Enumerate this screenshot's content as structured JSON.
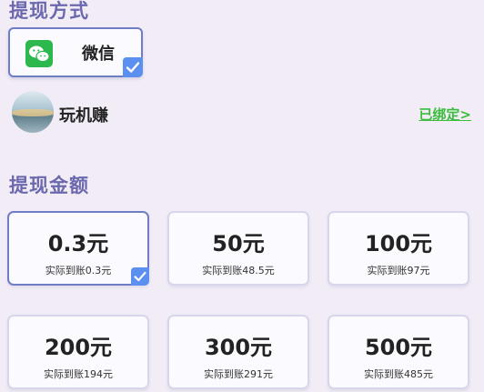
{
  "withdraw_method": {
    "title": "提现方式",
    "option": {
      "label": "微信",
      "icon": "wechat-icon",
      "selected": true
    },
    "account": {
      "name": "玩机赚",
      "bound_link": "已绑定>"
    }
  },
  "withdraw_amount": {
    "title": "提现金额",
    "options": [
      {
        "amount": "0.3元",
        "actual": "实际到账0.3元",
        "selected": true
      },
      {
        "amount": "50元",
        "actual": "实际到账48.5元",
        "selected": false
      },
      {
        "amount": "100元",
        "actual": "实际到账97元",
        "selected": false
      },
      {
        "amount": "200元",
        "actual": "实际到账194元",
        "selected": false
      },
      {
        "amount": "300元",
        "actual": "实际到账291元",
        "selected": false
      },
      {
        "amount": "500元",
        "actual": "实际到账485元",
        "selected": false
      }
    ]
  },
  "colors": {
    "accent": "#6f7ec4",
    "title": "#6b68ad",
    "check": "#5b8ff0",
    "link": "#3bbd3b",
    "wechat": "#2db84d",
    "background": "#f1ecf6"
  }
}
